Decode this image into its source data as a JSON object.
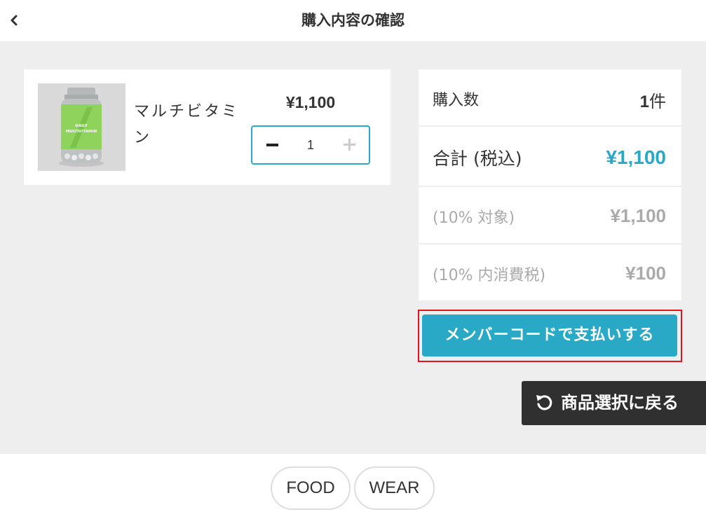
{
  "header": {
    "back_icon": "chevron-left-icon",
    "title": "購入内容の確認"
  },
  "cart": {
    "items": [
      {
        "name": "マルチビタミン",
        "image_label": "DAILY MULTIVITAMIN",
        "price": "¥1,100",
        "quantity": "1"
      }
    ]
  },
  "summary": {
    "count_label": "購入数",
    "count_value": "1",
    "count_unit": "件",
    "total_label": "合計 (税込)",
    "total_value": "¥1,100",
    "taxbase_label": "(10% 対象)",
    "taxbase_value": "¥1,100",
    "tax_label": "(10% 内消費税)",
    "tax_value": "¥100"
  },
  "actions": {
    "pay_label": "メンバーコードで支払いする",
    "return_label": "商品選択に戻る",
    "return_icon": "undo-icon"
  },
  "footer": {
    "tabs": [
      "FOOD",
      "WEAR"
    ]
  },
  "colors": {
    "accent": "#29a9c5",
    "highlight_outline": "#e0141b",
    "dark_button": "#303030",
    "background": "#eeeeee"
  }
}
